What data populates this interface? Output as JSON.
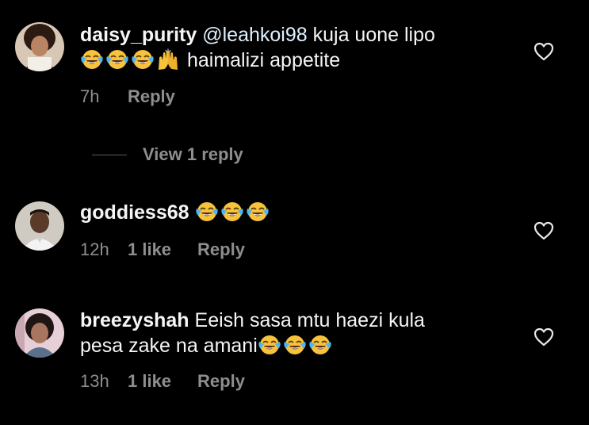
{
  "comments": [
    {
      "username": "daisy_purity",
      "mention": "@leahkoi98",
      "text_before": "kuja uone lipo",
      "text_after": "haimalizi appetite",
      "time": "7h",
      "likes": "",
      "reply": "Reply",
      "view_replies": "View 1 reply"
    },
    {
      "username": "goddiess68",
      "time": "12h",
      "likes": "1 like",
      "reply": "Reply"
    },
    {
      "username": "breezyshah",
      "text_line1": "Eeish sasa mtu haezi kula",
      "text_line2": "pesa zake na amani",
      "time": "13h",
      "likes": "1 like",
      "reply": "Reply"
    }
  ],
  "icons": {
    "emoji_laugh": "face-with-tears-of-joy-icon",
    "emoji_hands": "raising-hands-icon",
    "like": "heart-outline-icon"
  },
  "colors": {
    "background": "#000000",
    "primary_text": "#f5f5f5",
    "secondary_text": "#8e8e8e",
    "emoji_yellow": "#f7c23c"
  }
}
